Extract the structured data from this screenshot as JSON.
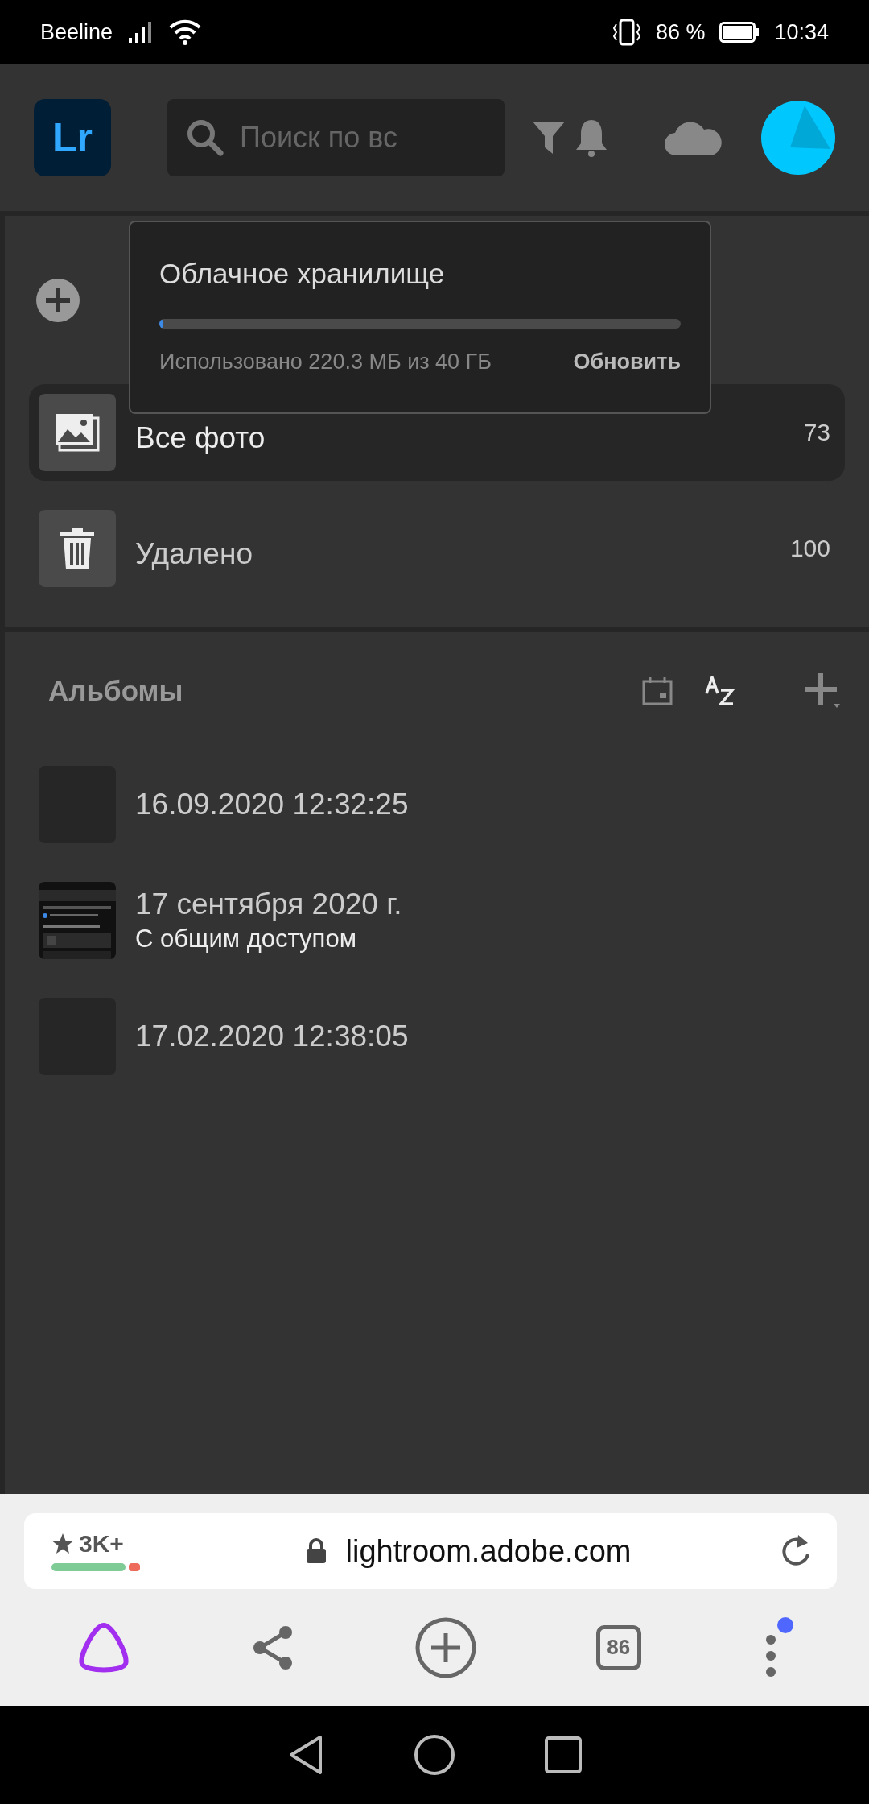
{
  "status_bar": {
    "carrier": "Beeline",
    "battery": "86 %",
    "time": "10:34"
  },
  "header": {
    "logo": "Lr",
    "search": {
      "placeholder": "Поиск по вс"
    }
  },
  "storage_popup": {
    "title": "Облачное хранилище",
    "level": 0.006,
    "usage": "Использовано 220.3 МБ из 40 ГБ",
    "action": "Обновить"
  },
  "library": [
    {
      "kind": "photos",
      "label": "Все фото",
      "count": "73",
      "selected": true
    },
    {
      "kind": "trash",
      "label": "Удалено",
      "count": "100",
      "selected": false
    }
  ],
  "albums": {
    "title": "Альбомы",
    "items": [
      {
        "kind": "blank",
        "title": "16.09.2020 12:32:25"
      },
      {
        "kind": "picture",
        "title": "17 сентября 2020 г.",
        "subtitle": "С общим доступом"
      },
      {
        "kind": "blank",
        "title": "17.02.2020 12:38:05"
      }
    ]
  },
  "browser": {
    "rating": "3K+",
    "url": "lightroom.adobe.com",
    "tabs_count": "86"
  }
}
